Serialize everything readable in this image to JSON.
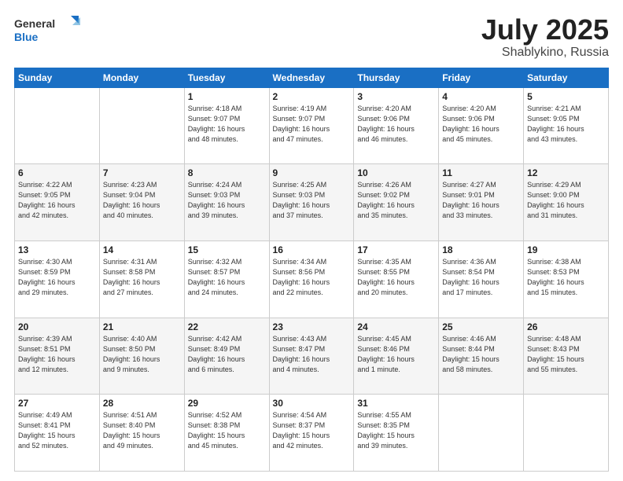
{
  "logo": {
    "line1": "General",
    "line2": "Blue"
  },
  "title": {
    "month": "July 2025",
    "location": "Shablykino, Russia"
  },
  "weekdays": [
    "Sunday",
    "Monday",
    "Tuesday",
    "Wednesday",
    "Thursday",
    "Friday",
    "Saturday"
  ],
  "weeks": [
    [
      {
        "day": "",
        "info": ""
      },
      {
        "day": "",
        "info": ""
      },
      {
        "day": "1",
        "info": "Sunrise: 4:18 AM\nSunset: 9:07 PM\nDaylight: 16 hours\nand 48 minutes."
      },
      {
        "day": "2",
        "info": "Sunrise: 4:19 AM\nSunset: 9:07 PM\nDaylight: 16 hours\nand 47 minutes."
      },
      {
        "day": "3",
        "info": "Sunrise: 4:20 AM\nSunset: 9:06 PM\nDaylight: 16 hours\nand 46 minutes."
      },
      {
        "day": "4",
        "info": "Sunrise: 4:20 AM\nSunset: 9:06 PM\nDaylight: 16 hours\nand 45 minutes."
      },
      {
        "day": "5",
        "info": "Sunrise: 4:21 AM\nSunset: 9:05 PM\nDaylight: 16 hours\nand 43 minutes."
      }
    ],
    [
      {
        "day": "6",
        "info": "Sunrise: 4:22 AM\nSunset: 9:05 PM\nDaylight: 16 hours\nand 42 minutes."
      },
      {
        "day": "7",
        "info": "Sunrise: 4:23 AM\nSunset: 9:04 PM\nDaylight: 16 hours\nand 40 minutes."
      },
      {
        "day": "8",
        "info": "Sunrise: 4:24 AM\nSunset: 9:03 PM\nDaylight: 16 hours\nand 39 minutes."
      },
      {
        "day": "9",
        "info": "Sunrise: 4:25 AM\nSunset: 9:03 PM\nDaylight: 16 hours\nand 37 minutes."
      },
      {
        "day": "10",
        "info": "Sunrise: 4:26 AM\nSunset: 9:02 PM\nDaylight: 16 hours\nand 35 minutes."
      },
      {
        "day": "11",
        "info": "Sunrise: 4:27 AM\nSunset: 9:01 PM\nDaylight: 16 hours\nand 33 minutes."
      },
      {
        "day": "12",
        "info": "Sunrise: 4:29 AM\nSunset: 9:00 PM\nDaylight: 16 hours\nand 31 minutes."
      }
    ],
    [
      {
        "day": "13",
        "info": "Sunrise: 4:30 AM\nSunset: 8:59 PM\nDaylight: 16 hours\nand 29 minutes."
      },
      {
        "day": "14",
        "info": "Sunrise: 4:31 AM\nSunset: 8:58 PM\nDaylight: 16 hours\nand 27 minutes."
      },
      {
        "day": "15",
        "info": "Sunrise: 4:32 AM\nSunset: 8:57 PM\nDaylight: 16 hours\nand 24 minutes."
      },
      {
        "day": "16",
        "info": "Sunrise: 4:34 AM\nSunset: 8:56 PM\nDaylight: 16 hours\nand 22 minutes."
      },
      {
        "day": "17",
        "info": "Sunrise: 4:35 AM\nSunset: 8:55 PM\nDaylight: 16 hours\nand 20 minutes."
      },
      {
        "day": "18",
        "info": "Sunrise: 4:36 AM\nSunset: 8:54 PM\nDaylight: 16 hours\nand 17 minutes."
      },
      {
        "day": "19",
        "info": "Sunrise: 4:38 AM\nSunset: 8:53 PM\nDaylight: 16 hours\nand 15 minutes."
      }
    ],
    [
      {
        "day": "20",
        "info": "Sunrise: 4:39 AM\nSunset: 8:51 PM\nDaylight: 16 hours\nand 12 minutes."
      },
      {
        "day": "21",
        "info": "Sunrise: 4:40 AM\nSunset: 8:50 PM\nDaylight: 16 hours\nand 9 minutes."
      },
      {
        "day": "22",
        "info": "Sunrise: 4:42 AM\nSunset: 8:49 PM\nDaylight: 16 hours\nand 6 minutes."
      },
      {
        "day": "23",
        "info": "Sunrise: 4:43 AM\nSunset: 8:47 PM\nDaylight: 16 hours\nand 4 minutes."
      },
      {
        "day": "24",
        "info": "Sunrise: 4:45 AM\nSunset: 8:46 PM\nDaylight: 16 hours\nand 1 minute."
      },
      {
        "day": "25",
        "info": "Sunrise: 4:46 AM\nSunset: 8:44 PM\nDaylight: 15 hours\nand 58 minutes."
      },
      {
        "day": "26",
        "info": "Sunrise: 4:48 AM\nSunset: 8:43 PM\nDaylight: 15 hours\nand 55 minutes."
      }
    ],
    [
      {
        "day": "27",
        "info": "Sunrise: 4:49 AM\nSunset: 8:41 PM\nDaylight: 15 hours\nand 52 minutes."
      },
      {
        "day": "28",
        "info": "Sunrise: 4:51 AM\nSunset: 8:40 PM\nDaylight: 15 hours\nand 49 minutes."
      },
      {
        "day": "29",
        "info": "Sunrise: 4:52 AM\nSunset: 8:38 PM\nDaylight: 15 hours\nand 45 minutes."
      },
      {
        "day": "30",
        "info": "Sunrise: 4:54 AM\nSunset: 8:37 PM\nDaylight: 15 hours\nand 42 minutes."
      },
      {
        "day": "31",
        "info": "Sunrise: 4:55 AM\nSunset: 8:35 PM\nDaylight: 15 hours\nand 39 minutes."
      },
      {
        "day": "",
        "info": ""
      },
      {
        "day": "",
        "info": ""
      }
    ]
  ]
}
